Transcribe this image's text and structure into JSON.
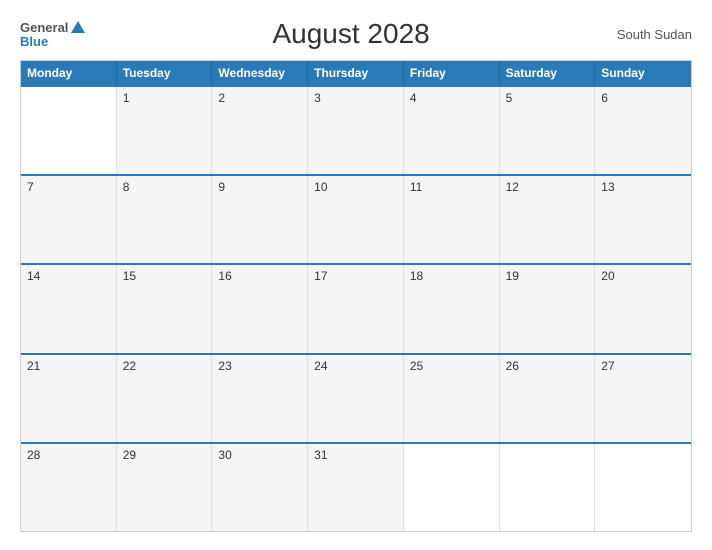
{
  "header": {
    "logo_general": "General",
    "logo_blue": "Blue",
    "title": "August 2028",
    "country": "South Sudan"
  },
  "calendar": {
    "days_of_week": [
      "Monday",
      "Tuesday",
      "Wednesday",
      "Thursday",
      "Friday",
      "Saturday",
      "Sunday"
    ],
    "weeks": [
      [
        {
          "day": "",
          "empty": true
        },
        {
          "day": "1"
        },
        {
          "day": "2"
        },
        {
          "day": "3"
        },
        {
          "day": "4"
        },
        {
          "day": "5"
        },
        {
          "day": "6"
        }
      ],
      [
        {
          "day": "7"
        },
        {
          "day": "8"
        },
        {
          "day": "9"
        },
        {
          "day": "10"
        },
        {
          "day": "11"
        },
        {
          "day": "12"
        },
        {
          "day": "13"
        }
      ],
      [
        {
          "day": "14"
        },
        {
          "day": "15"
        },
        {
          "day": "16"
        },
        {
          "day": "17"
        },
        {
          "day": "18"
        },
        {
          "day": "19"
        },
        {
          "day": "20"
        }
      ],
      [
        {
          "day": "21"
        },
        {
          "day": "22"
        },
        {
          "day": "23"
        },
        {
          "day": "24"
        },
        {
          "day": "25"
        },
        {
          "day": "26"
        },
        {
          "day": "27"
        }
      ],
      [
        {
          "day": "28"
        },
        {
          "day": "29"
        },
        {
          "day": "30"
        },
        {
          "day": "31"
        },
        {
          "day": "",
          "empty": true
        },
        {
          "day": "",
          "empty": true
        },
        {
          "day": "",
          "empty": true
        }
      ]
    ]
  }
}
